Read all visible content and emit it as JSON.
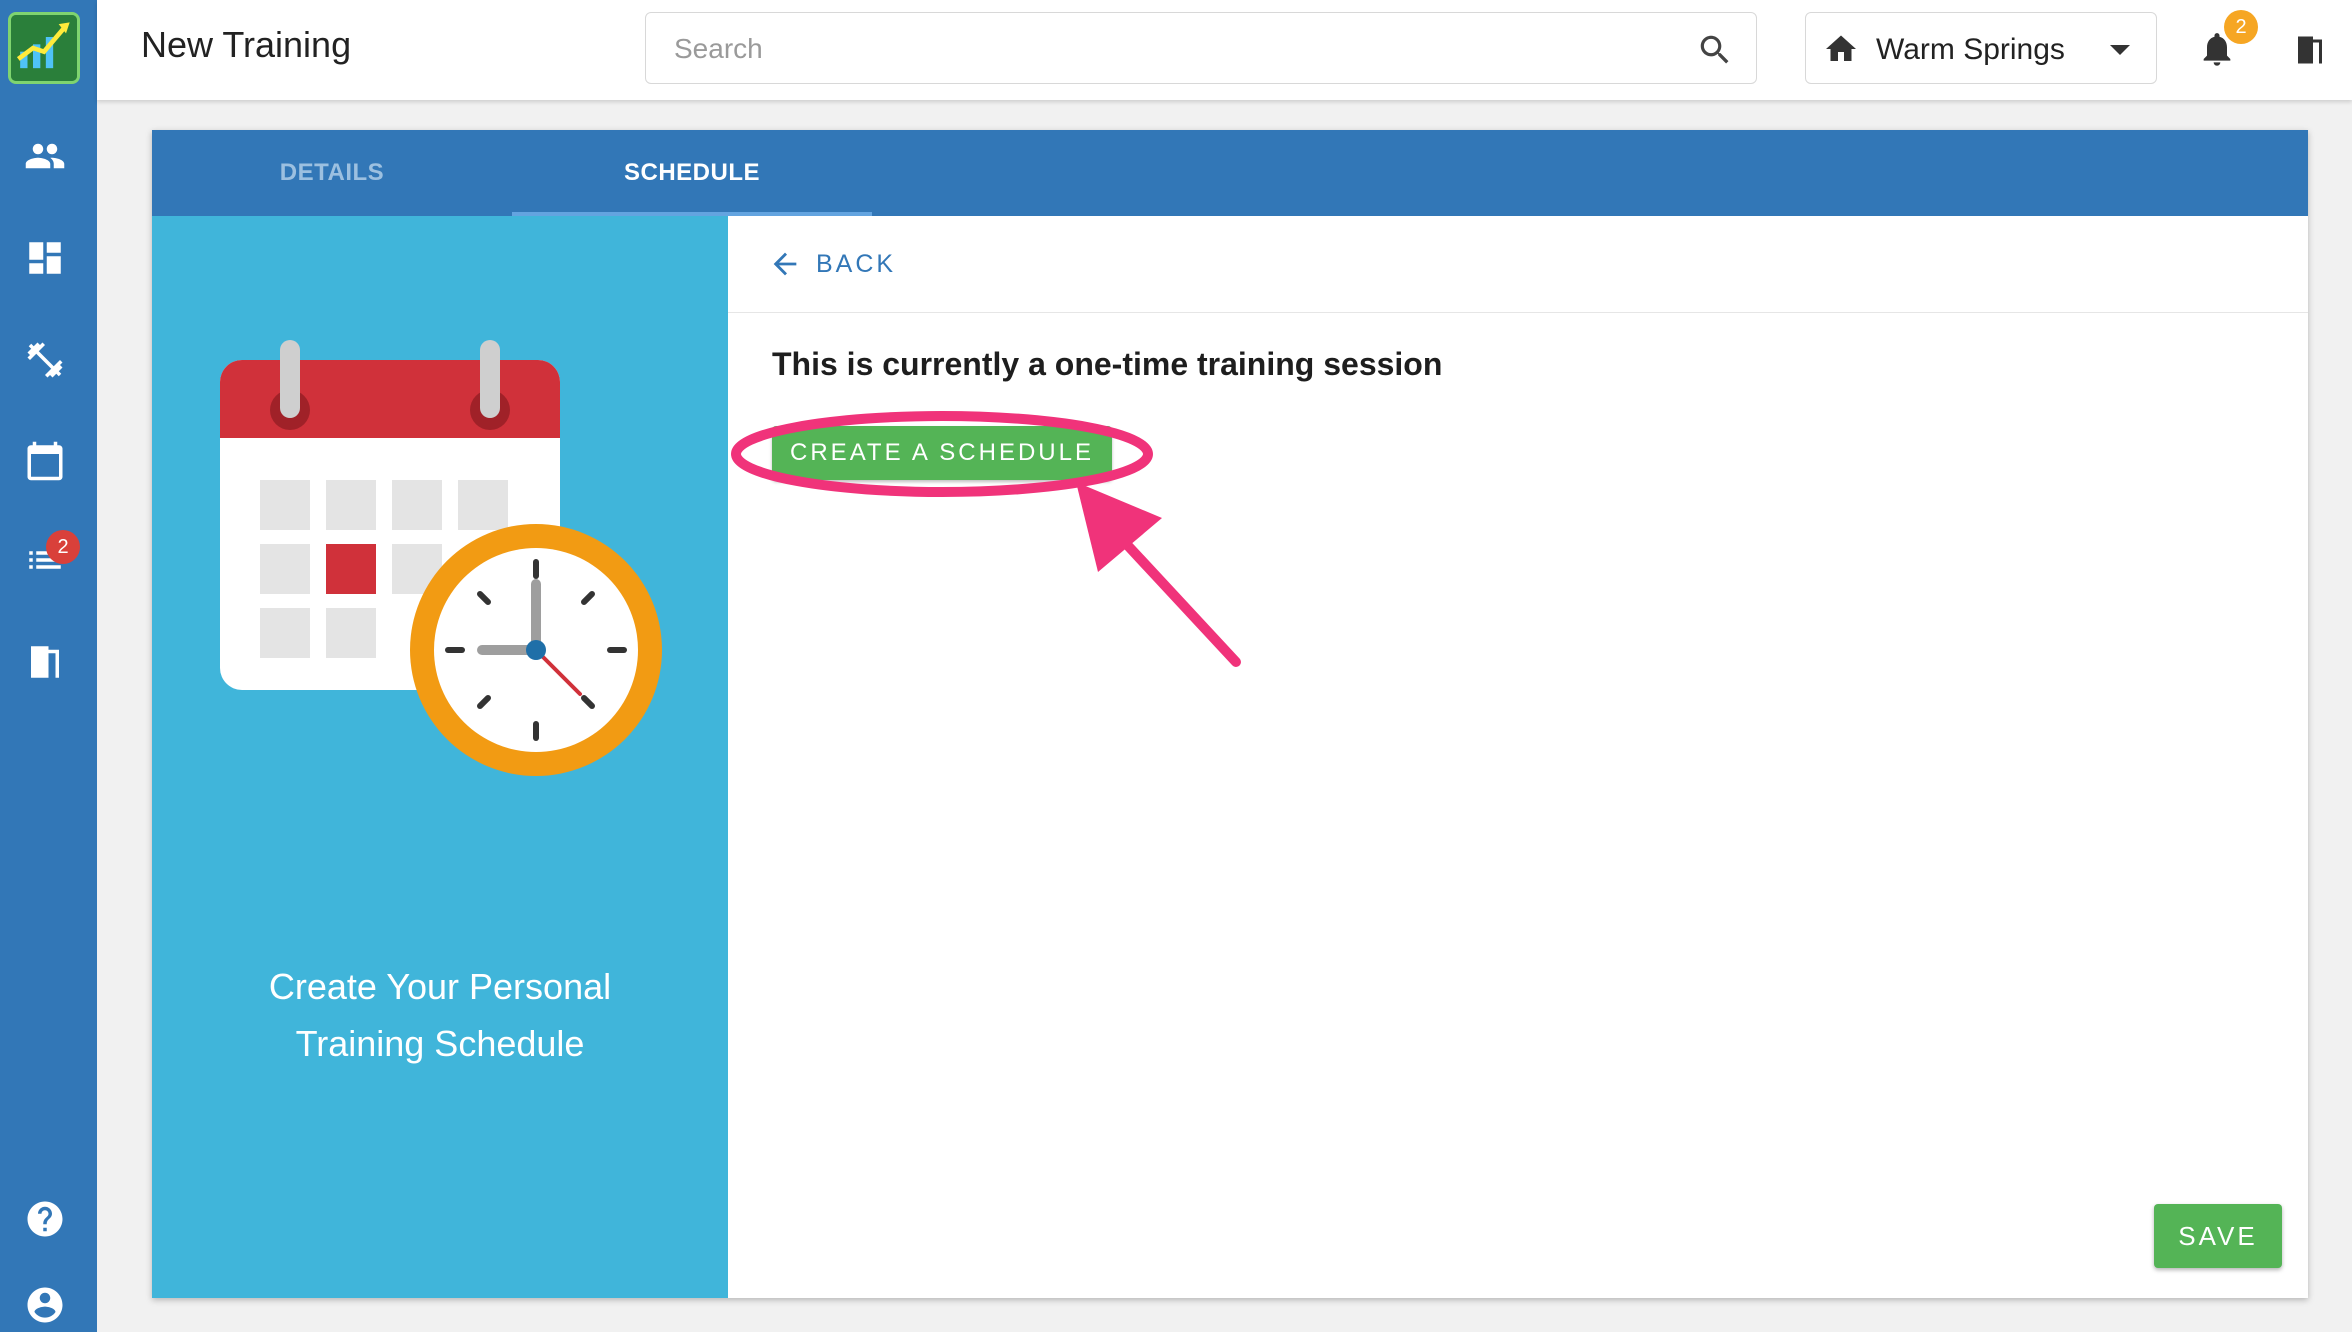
{
  "header": {
    "title": "New Training",
    "search_placeholder": "Search",
    "location": "Warm Springs",
    "notification_count": "2"
  },
  "sidebar": {
    "items": [
      {
        "icon": "people-icon"
      },
      {
        "icon": "dashboard-icon"
      },
      {
        "icon": "dumbbell-icon"
      },
      {
        "icon": "calendar-icon"
      },
      {
        "icon": "list-icon",
        "badge": "2"
      },
      {
        "icon": "door-exit-icon"
      },
      {
        "icon": "help-icon"
      },
      {
        "icon": "account-icon"
      }
    ]
  },
  "tabs": [
    {
      "label": "DETAILS",
      "active": false
    },
    {
      "label": "SCHEDULE",
      "active": true
    }
  ],
  "left_panel": {
    "line1": "Create Your Personal",
    "line2": "Training Schedule"
  },
  "main": {
    "back_label": "BACK",
    "status_text": "This is currently a one-time training session",
    "create_button": "CREATE A SCHEDULE",
    "save_button": "SAVE"
  },
  "colors": {
    "primary": "#3277b7",
    "panel": "#40b5da",
    "success": "#54b456",
    "annotation": "#f0337a"
  }
}
